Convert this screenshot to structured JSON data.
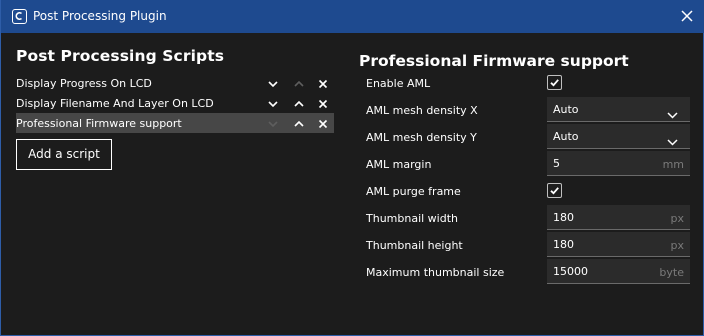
{
  "window": {
    "title": "Post Processing Plugin"
  },
  "left": {
    "heading": "Post Processing Scripts",
    "scripts": [
      {
        "label": "Display Progress On LCD",
        "selected": false,
        "up_enabled": false,
        "down_enabled": true
      },
      {
        "label": "Display Filename And Layer On LCD",
        "selected": false,
        "up_enabled": true,
        "down_enabled": true
      },
      {
        "label": "Professional Firmware support",
        "selected": true,
        "up_enabled": true,
        "down_enabled": false
      }
    ],
    "add_button": "Add a script"
  },
  "right": {
    "heading": "Professional Firmware support",
    "settings": [
      {
        "label": "Enable AML",
        "type": "checkbox",
        "checked": true
      },
      {
        "label": "AML mesh density X",
        "type": "select",
        "value": "Auto"
      },
      {
        "label": "AML mesh density Y",
        "type": "select",
        "value": "Auto"
      },
      {
        "label": "AML margin",
        "type": "number",
        "value": "5",
        "unit": "mm"
      },
      {
        "label": "AML purge frame",
        "type": "checkbox",
        "checked": true
      },
      {
        "label": "Thumbnail width",
        "type": "number",
        "value": "180",
        "unit": "px"
      },
      {
        "label": "Thumbnail height",
        "type": "number",
        "value": "180",
        "unit": "px"
      },
      {
        "label": "Maximum thumbnail size",
        "type": "number",
        "value": "15000",
        "unit": "byte"
      }
    ]
  },
  "colors": {
    "titlebar": "#1e4a8f",
    "background": "#1c1c1c",
    "selected_row": "#474747",
    "field_bg": "#2b2b2b",
    "unit_text": "#7a7a7a",
    "disabled_arrow": "#5e5e5e"
  },
  "icons": {
    "app": "cura-logo-icon",
    "close": "close-icon",
    "move_down": "chevron-down-icon",
    "move_up": "chevron-up-icon",
    "remove": "remove-x-icon",
    "check": "checkmark-icon",
    "dropdown": "chevron-down-icon"
  }
}
